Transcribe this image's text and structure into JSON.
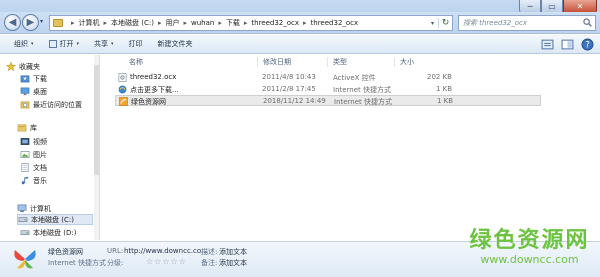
{
  "window": {
    "controls": {
      "minimize": "─",
      "maximize": "▭",
      "close": "✕"
    }
  },
  "nav": {
    "back_glyph": "◀",
    "forward_glyph": "▶",
    "history_glyph": "▾",
    "breadcrumb": [
      "计算机",
      "本地磁盘 (C:)",
      "用户",
      "wuhan",
      "下载",
      "threed32_ocx",
      "threed32_ocx"
    ],
    "separator": "▸",
    "dropdown_glyph": "▾",
    "refresh_glyph": "↻"
  },
  "search": {
    "placeholder": "搜索 threed32_ocx"
  },
  "toolbar": {
    "organize": "组织",
    "open": "打开",
    "share": "共享",
    "print": "打印",
    "new_folder": "新建文件夹",
    "caret": "▾"
  },
  "sidebar": {
    "favorites": "收藏夹",
    "downloads": "下载",
    "desktop": "桌面",
    "recent": "最近访问的位置",
    "libraries": "库",
    "videos": "视频",
    "pictures": "图片",
    "documents": "文档",
    "music": "音乐",
    "computer": "计算机",
    "drive_c": "本地磁盘 (C:)",
    "drive_d": "本地磁盘 (D:)"
  },
  "columns": {
    "name": "名称",
    "date": "修改日期",
    "type": "类型",
    "size": "大小"
  },
  "files": [
    {
      "name": "threed32.ocx",
      "date": "2011/4/8 10:43",
      "type": "ActiveX 控件",
      "size": "202 KB",
      "icon": "ocx-file-icon"
    },
    {
      "name": "点击更多下载...",
      "date": "2011/2/8 17:45",
      "type": "Internet 快捷方式",
      "size": "1 KB",
      "icon": "internet-shortcut-icon"
    },
    {
      "name": "绿色资源网",
      "date": "2018/11/12 14:49",
      "type": "Internet 快捷方式",
      "size": "1 KB",
      "icon": "green-site-icon"
    }
  ],
  "details": {
    "name": "绿色资源网",
    "kind": "Internet 快捷方式",
    "url_label": "URL:",
    "url_value": "http://www.downcc.co...",
    "rating_label": "分级:",
    "rating_stars": [
      "☆",
      "☆",
      "☆",
      "☆",
      "☆"
    ],
    "desc_label": "描述:",
    "desc_value": "添加文本",
    "remarks_label": "备注:",
    "remarks_value": "添加文本"
  },
  "watermark": {
    "title": "绿色资源网",
    "url": "www.downcc.com"
  },
  "colors": {
    "folder": "#e4c45a",
    "accent": "#5d7fa8",
    "watermark": "#6cc33f",
    "selection": "#eaeaea"
  }
}
